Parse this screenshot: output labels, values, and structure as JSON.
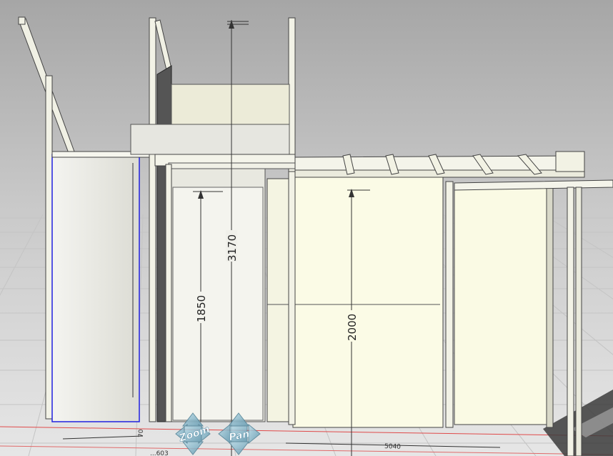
{
  "scene": {
    "background_top": "#a8a8a8",
    "background_bottom": "#e4e4e4",
    "grid_color": "#c9c9c9",
    "axis_color": "#e04040",
    "selection_color": "#2020e0",
    "panel_color": "#fbfbe6",
    "frame_color": "#f2f2de"
  },
  "dimensions": {
    "total_height": "3170",
    "left_opening": "1850",
    "right_opening": "2000",
    "bottom_width": "5040",
    "bottom_left": "...603",
    "side_small": "70"
  },
  "nav": {
    "zoom_label": "Zoom",
    "pan_label": "Pan",
    "zoom_icon": "zoom-arrows-icon",
    "pan_icon": "pan-arrows-icon",
    "icon_color": "#7fb3c9"
  }
}
